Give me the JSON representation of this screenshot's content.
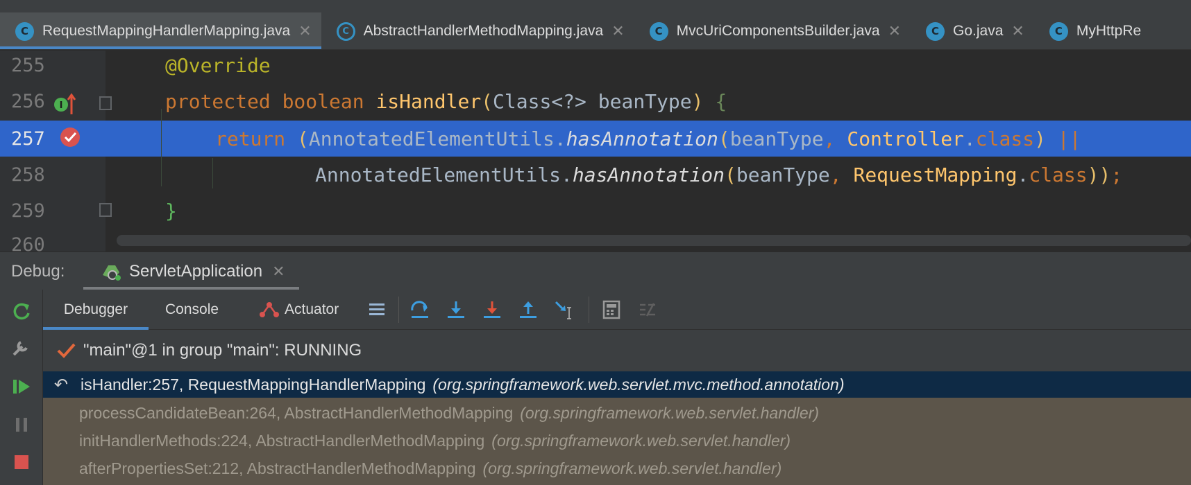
{
  "tabs": [
    {
      "label": "RequestMappingHandlerMapping.java",
      "icon": "class-icon",
      "active": true
    },
    {
      "label": "AbstractHandlerMethodMapping.java",
      "icon": "abstract-class-icon",
      "active": false
    },
    {
      "label": "MvcUriComponentsBuilder.java",
      "icon": "class-icon",
      "active": false
    },
    {
      "label": "Go.java",
      "icon": "class-icon",
      "active": false
    },
    {
      "label": "MyHttpRe",
      "icon": "class-icon",
      "active": false
    }
  ],
  "tab_icon_letter": "C",
  "editor": {
    "lines": [
      {
        "num": "255"
      },
      {
        "num": "256"
      },
      {
        "num": "257"
      },
      {
        "num": "258"
      },
      {
        "num": "259"
      },
      {
        "num": "260"
      }
    ],
    "code": {
      "l255": {
        "ann": "@Override"
      },
      "l256": {
        "kw1": "protected",
        "kw2": "boolean",
        "fn": "isHandler",
        "open": "(",
        "type": "Class<?>",
        "param": "beanType",
        "close": ")",
        "brace": "{"
      },
      "l257": {
        "kw": "return",
        "open": "(",
        "util": "AnnotatedElementUtils.",
        "method": "hasAnnotation",
        "lp": "(",
        "arg": "beanType",
        "comma": ",",
        "cls": "Controller",
        "dot": ".",
        "kwcls": "class",
        "rp": ")",
        "or": "||"
      },
      "l258": {
        "util": "AnnotatedElementUtils.",
        "method": "hasAnnotation",
        "lp": "(",
        "arg": "beanType",
        "comma": ",",
        "cls": "RequestMapping",
        "dot": ".",
        "kwcls": "class",
        "rp": "))",
        "semi": ";"
      },
      "l259": {
        "brace": "}"
      }
    }
  },
  "debug": {
    "title": "Debug:",
    "run_config": "ServletApplication",
    "tabs": {
      "debugger": "Debugger",
      "console": "Console",
      "actuator": "Actuator"
    },
    "thread": "\"main\"@1 in group \"main\": RUNNING",
    "frames": [
      {
        "method": "isHandler:257, RequestMappingHandlerMapping",
        "pkg": "(org.springframework.web.servlet.mvc.method.annotation)",
        "selected": true
      },
      {
        "method": "processCandidateBean:264, AbstractHandlerMethodMapping",
        "pkg": "(org.springframework.web.servlet.handler)",
        "selected": false
      },
      {
        "method": "initHandlerMethods:224, AbstractHandlerMethodMapping",
        "pkg": "(org.springframework.web.servlet.handler)",
        "selected": false
      },
      {
        "method": "afterPropertiesSet:212, AbstractHandlerMethodMapping",
        "pkg": "(org.springframework.web.servlet.handler)",
        "selected": false
      }
    ]
  },
  "colors": {
    "accent": "#4a88c7",
    "highlight_line": "#2f65ca",
    "selected_frame": "#0e2a45",
    "frames_bg": "#5c554a",
    "breakpoint": "#d9534f",
    "run_green": "#4caf50"
  }
}
